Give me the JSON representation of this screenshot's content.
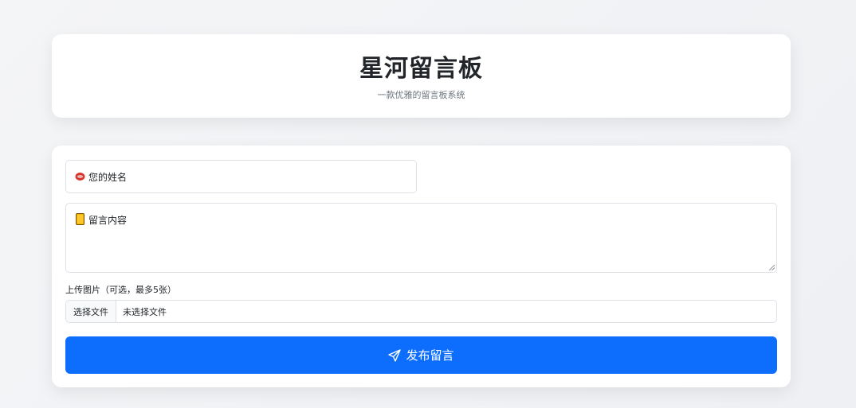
{
  "header": {
    "title": "星河留言板",
    "subtitle": "一款优雅的留言板系统"
  },
  "form": {
    "name_placeholder": "您的姓名",
    "name_icon": "lips-emoji-icon",
    "message_placeholder": "留言内容",
    "message_icon": "notepad-emoji-icon",
    "upload_label": "上传图片（可选，最多5张）",
    "file_button_label": "选择文件",
    "file_status": "未选择文件",
    "submit_label": "发布留言",
    "submit_icon": "send-icon"
  },
  "colors": {
    "primary": "#0d6efd",
    "card_bg": "#ffffff",
    "page_bg": "#f4f5f7"
  }
}
